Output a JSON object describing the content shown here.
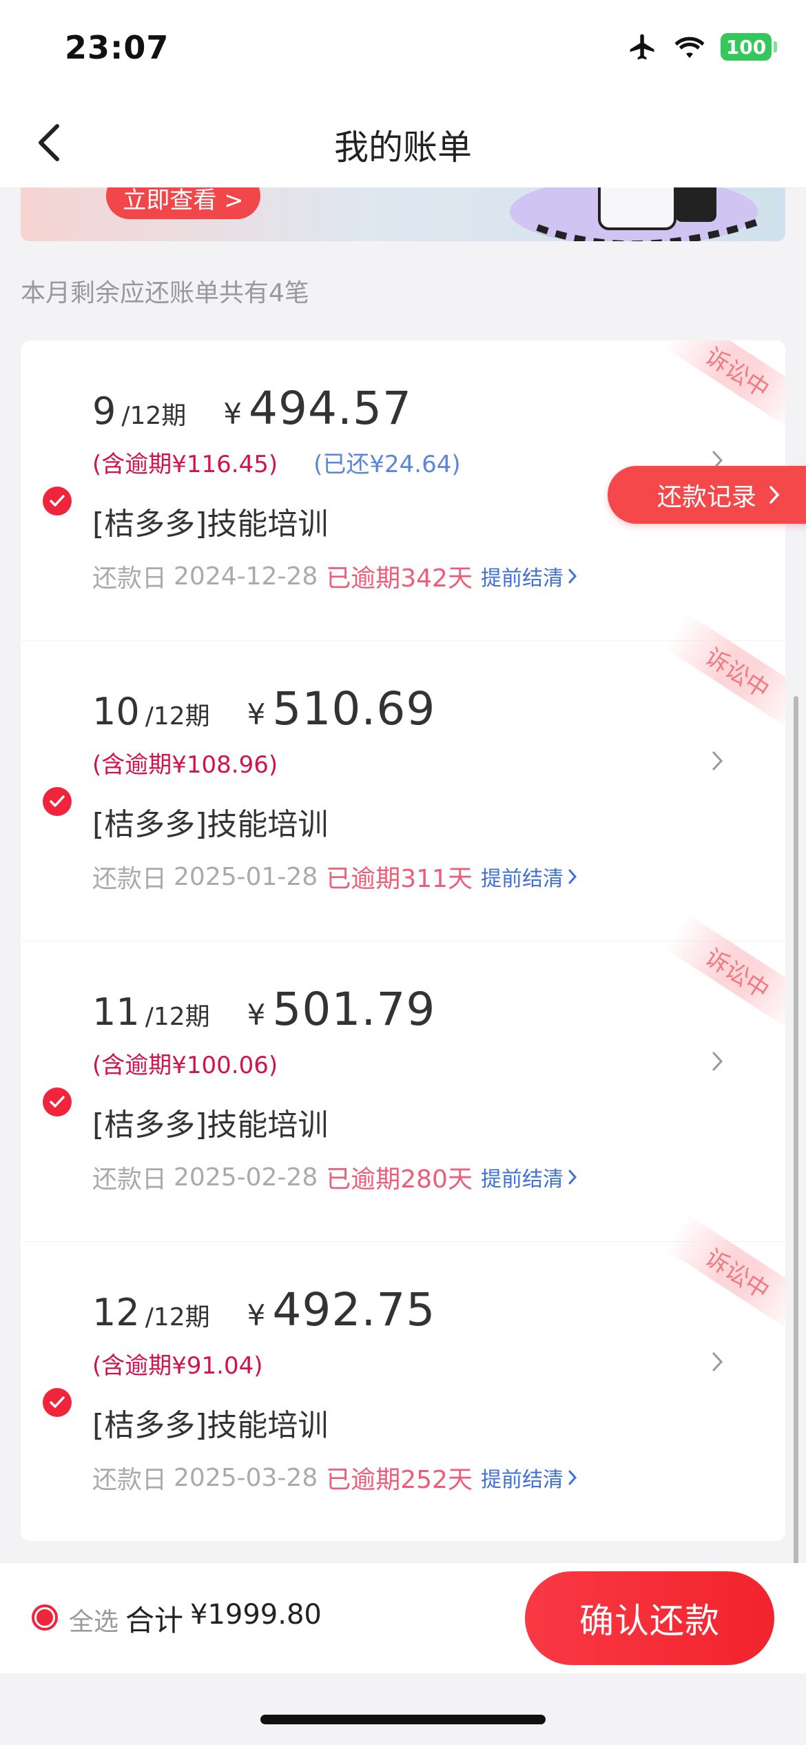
{
  "status_bar": {
    "time": "23:07",
    "battery": "100"
  },
  "nav": {
    "title": "我的账单"
  },
  "banner": {
    "button_label": "立即查看 >"
  },
  "summary": {
    "text": "本月剩余应还账单共有4笔"
  },
  "ribbon_label": "诉讼中",
  "repay_record_label": "还款记录",
  "due_label": "还款日",
  "prepay_label": "提前结清",
  "bills": [
    {
      "period": "9",
      "total_periods": "/12期",
      "currency": "¥",
      "amount": "494.57",
      "overdue_included": "(含逾期¥116.45)",
      "paid": "(已还¥24.64)",
      "name": "[桔多多]技能培训",
      "due_date": "2024-12-28",
      "overdue_days": "已逾期342天"
    },
    {
      "period": "10",
      "total_periods": "/12期",
      "currency": "¥",
      "amount": "510.69",
      "overdue_included": "(含逾期¥108.96)",
      "paid": "",
      "name": "[桔多多]技能培训",
      "due_date": "2025-01-28",
      "overdue_days": "已逾期311天"
    },
    {
      "period": "11",
      "total_periods": "/12期",
      "currency": "¥",
      "amount": "501.79",
      "overdue_included": "(含逾期¥100.06)",
      "paid": "",
      "name": "[桔多多]技能培训",
      "due_date": "2025-02-28",
      "overdue_days": "已逾期280天"
    },
    {
      "period": "12",
      "total_periods": "/12期",
      "currency": "¥",
      "amount": "492.75",
      "overdue_included": "(含逾期¥91.04)",
      "paid": "",
      "name": "[桔多多]技能培训",
      "due_date": "2025-03-28",
      "overdue_days": "已逾期252天"
    }
  ],
  "bottom": {
    "select_all": "全选",
    "total_label": "合计",
    "total_amount": "¥1999.80",
    "confirm_label": "确认还款"
  },
  "colors": {
    "accent_red": "#f0243a",
    "overdue_text": "#d1124e",
    "link_blue": "#3f71d6"
  }
}
